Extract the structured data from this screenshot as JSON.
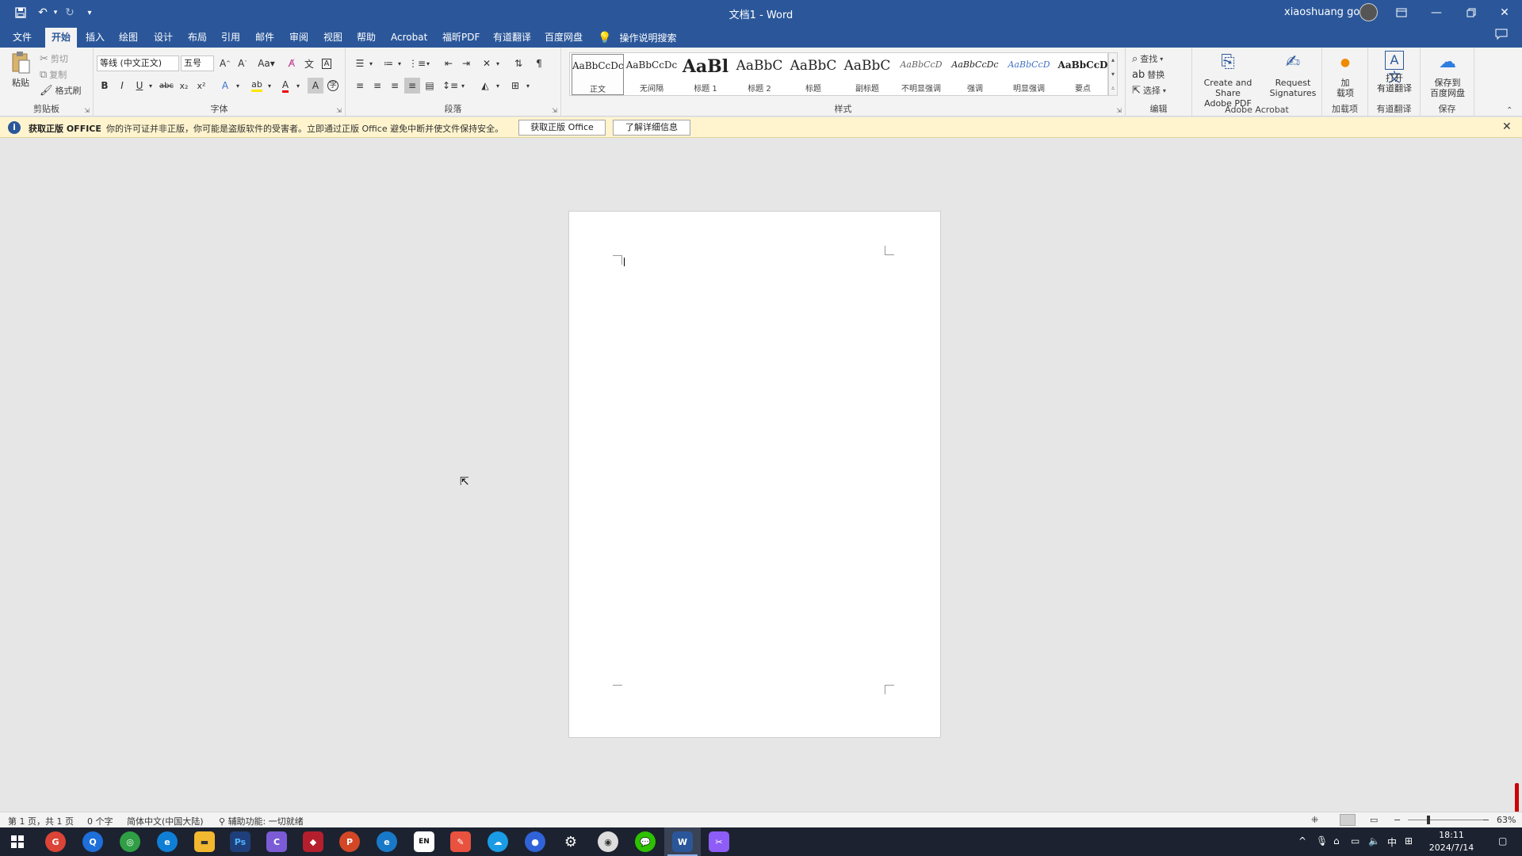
{
  "titlebar": {
    "title": "文档1 - Word",
    "user": "xiaoshuang gou",
    "quick_access": [
      "save-icon",
      "undo-icon",
      "redo-icon",
      "customize-icon"
    ]
  },
  "tabs": [
    {
      "label": "文件"
    },
    {
      "label": "开始"
    },
    {
      "label": "插入"
    },
    {
      "label": "绘图"
    },
    {
      "label": "设计"
    },
    {
      "label": "布局"
    },
    {
      "label": "引用"
    },
    {
      "label": "邮件"
    },
    {
      "label": "审阅"
    },
    {
      "label": "视图"
    },
    {
      "label": "帮助"
    },
    {
      "label": "Acrobat"
    },
    {
      "label": "福昕PDF"
    },
    {
      "label": "有道翻译"
    },
    {
      "label": "百度网盘"
    }
  ],
  "active_tab": "开始",
  "tellme": "操作说明搜索",
  "ribbon": {
    "clipboard": {
      "paste": "粘贴",
      "cut": "剪切",
      "copy": "复制",
      "format_painter": "格式刷",
      "label": "剪贴板"
    },
    "font": {
      "font_name": "等线 (中文正文)",
      "font_size": "五号",
      "label": "字体"
    },
    "paragraph": {
      "label": "段落"
    },
    "styles": {
      "label": "样式",
      "items": [
        {
          "preview": "AaBbCcDc",
          "name": "正文"
        },
        {
          "preview": "AaBbCcDc",
          "name": "无间隔"
        },
        {
          "preview": "AaBl",
          "name": "标题 1"
        },
        {
          "preview": "AaBbC",
          "name": "标题 2"
        },
        {
          "preview": "AaBbC",
          "name": "标题"
        },
        {
          "preview": "AaBbC",
          "name": "副标题"
        },
        {
          "preview": "AaBbCcD",
          "name": "不明显强调"
        },
        {
          "preview": "AaBbCcDc",
          "name": "强调"
        },
        {
          "preview": "AaBbCcD",
          "name": "明显强调"
        },
        {
          "preview": "AaBbCcD",
          "name": "要点"
        }
      ]
    },
    "editing": {
      "find": "查找",
      "replace": "替换",
      "select": "选择",
      "label": "编辑"
    },
    "acrobat": {
      "create_line1": "Create and Share",
      "create_line2": "Adobe PDF",
      "request_line1": "Request",
      "request_line2": "Signatures",
      "label": "Adobe Acrobat"
    },
    "addins": {
      "line1": "加",
      "line2": "载项",
      "label": "加载项"
    },
    "youdao": {
      "line1": "打开",
      "line2": "有道翻译",
      "label": "有道翻译"
    },
    "baidu": {
      "line1": "保存到",
      "line2": "百度网盘",
      "label": "保存"
    }
  },
  "notification": {
    "title": "获取正版 OFFICE",
    "message": "你的许可证并非正版，你可能是盗版软件的受害者。立即通过正版 Office 避免中断并使文件保持安全。",
    "button1": "获取正版 Office",
    "button2": "了解详细信息"
  },
  "statusbar": {
    "page": "第 1 页，共 1 页",
    "words": "0 个字",
    "language": "简体中文(中国大陆)",
    "accessibility": "辅助功能: 一切就绪",
    "zoom": "63%"
  },
  "taskbar": {
    "time": "18:11",
    "date": "2024/7/14",
    "ime": "中",
    "lang_badge": "EN"
  },
  "colors": {
    "brand": "#2b579a",
    "ribbon": "#f3f3f3",
    "notify": "#fff4ce",
    "taskbar": "#1c2230"
  }
}
